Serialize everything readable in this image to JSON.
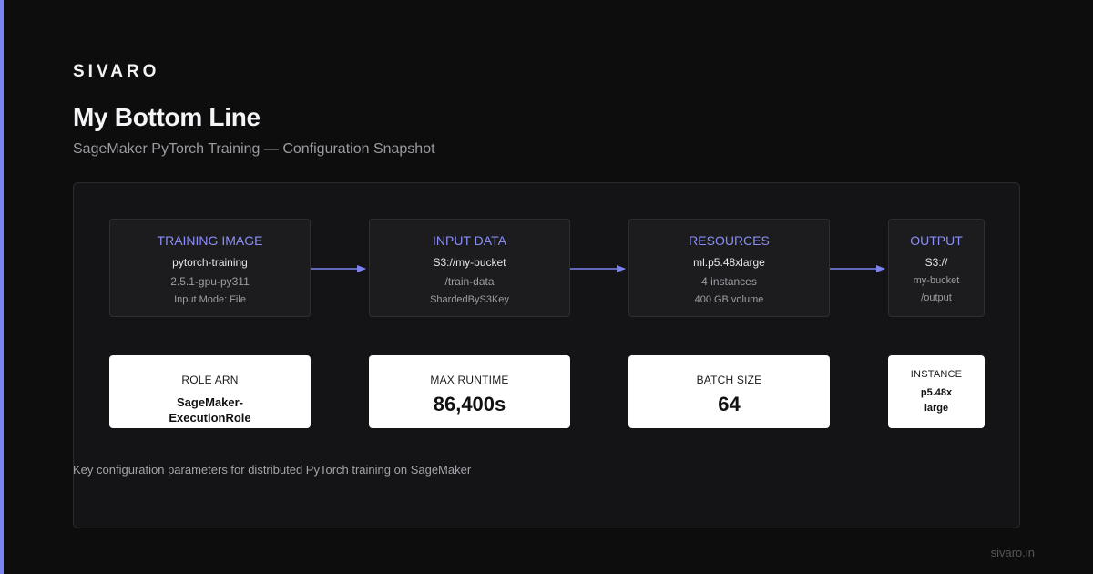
{
  "brand": "SIVARO",
  "title": "My Bottom Line",
  "subtitle": "SageMaker PyTorch Training — Configuration Snapshot",
  "flow": [
    {
      "head": "TRAINING IMAGE",
      "l1": "pytorch-training",
      "l2": "2.5.1-gpu-py311",
      "l3": "Input Mode: File"
    },
    {
      "head": "INPUT DATA",
      "l1": "S3://my-bucket",
      "l2": "/train-data",
      "l3": "ShardedByS3Key"
    },
    {
      "head": "RESOURCES",
      "l1": "ml.p5.48xlarge",
      "l2": "4 instances",
      "l3": "400 GB volume"
    },
    {
      "head": "OUTPUT",
      "l1": "S3://",
      "l2": "my-bucket",
      "l3": "/output"
    }
  ],
  "stats": [
    {
      "label": "ROLE ARN",
      "line1": "SageMaker-",
      "line2": "ExecutionRole"
    },
    {
      "label": "MAX RUNTIME",
      "value": "86,400s"
    },
    {
      "label": "BATCH SIZE",
      "value": "64"
    },
    {
      "label": "INSTANCE",
      "line1": "p5.48x",
      "line2": "large"
    }
  ],
  "caption": "Key configuration parameters for distributed PyTorch training on SageMaker",
  "footer": "sivaro.in",
  "colors": {
    "accent": "#7b83f0",
    "background": "#0d0d0e",
    "panel": "#141416"
  }
}
